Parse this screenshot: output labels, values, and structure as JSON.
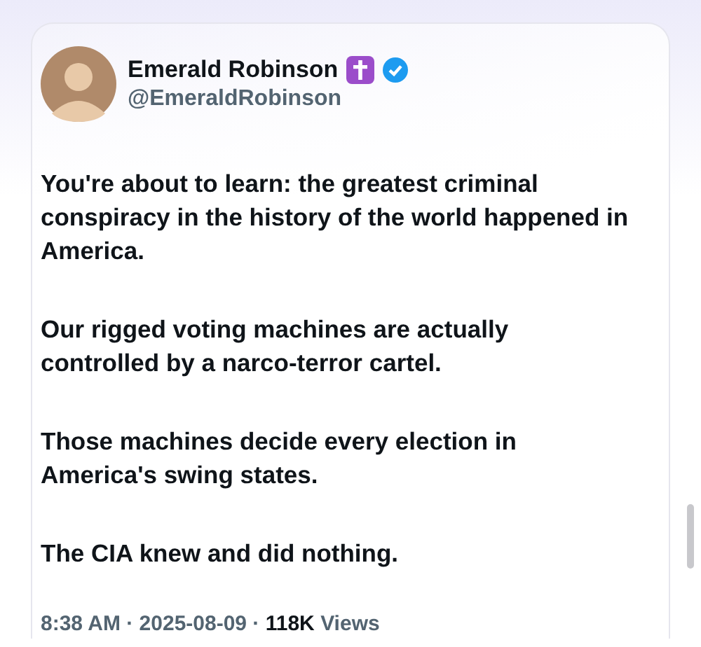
{
  "post": {
    "author": {
      "name": "Emerald Robinson",
      "handle": "@EmeraldRobinson",
      "verified": true
    },
    "paragraphs": [
      "You're about to learn: the greatest criminal conspiracy in the history of the world happened in America.",
      "Our rigged voting machines are actually controlled by a narco-terror cartel.",
      "Those machines decide every election in America's swing states.",
      "The CIA knew and did nothing."
    ],
    "meta": "8:38 AM · 2025-08-09 · **118K** Views"
  }
}
